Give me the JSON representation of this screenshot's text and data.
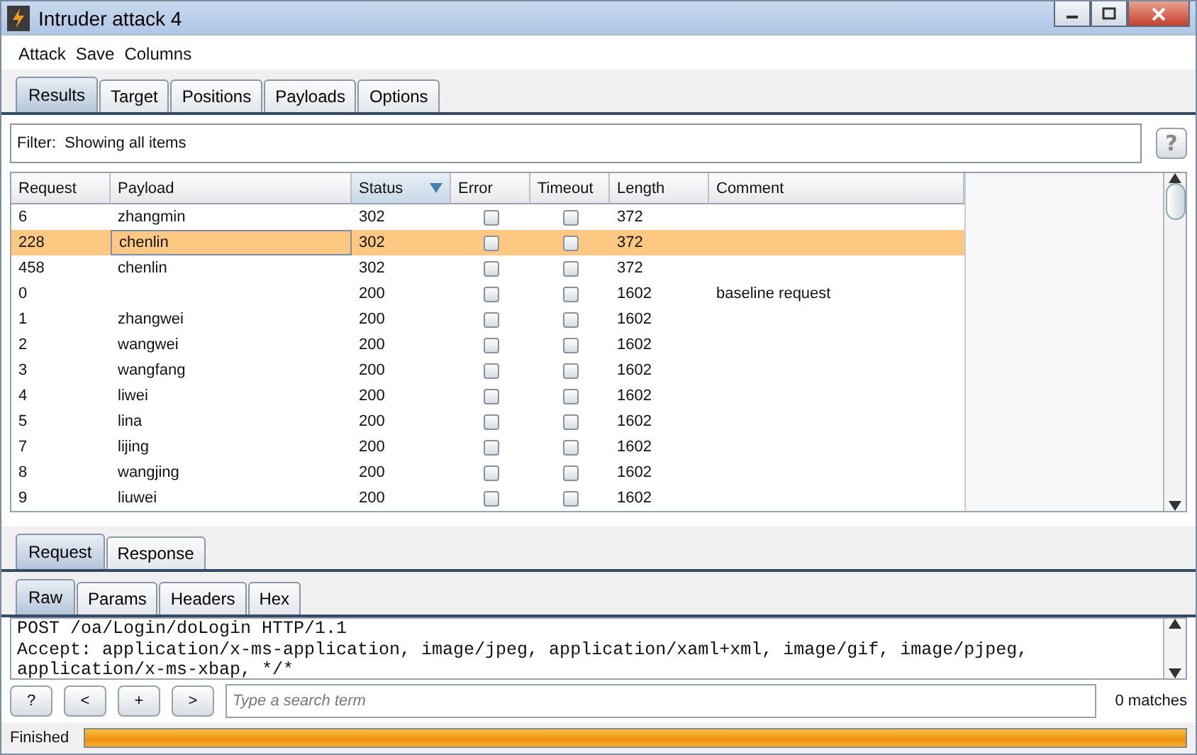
{
  "window": {
    "title": "Intruder attack 4"
  },
  "menu": [
    "Attack",
    "Save",
    "Columns"
  ],
  "tabs": [
    {
      "label": "Results",
      "selected": true
    },
    {
      "label": "Target",
      "selected": false
    },
    {
      "label": "Positions",
      "selected": false
    },
    {
      "label": "Payloads",
      "selected": false
    },
    {
      "label": "Options",
      "selected": false
    }
  ],
  "filter": {
    "label": "Filter:",
    "text": "Showing all items",
    "help": "?"
  },
  "table": {
    "columns": [
      {
        "label": "Request",
        "sorted": false
      },
      {
        "label": "Payload",
        "sorted": false
      },
      {
        "label": "Status",
        "sorted": true
      },
      {
        "label": "Error",
        "sorted": false
      },
      {
        "label": "Timeout",
        "sorted": false
      },
      {
        "label": "Length",
        "sorted": false
      },
      {
        "label": "Comment",
        "sorted": false
      }
    ],
    "rows": [
      {
        "request": "6",
        "payload": "zhangmin",
        "status": "302",
        "error": false,
        "timeout": false,
        "length": "372",
        "comment": "",
        "selected": false
      },
      {
        "request": "228",
        "payload": "chenlin",
        "status": "302",
        "error": false,
        "timeout": false,
        "length": "372",
        "comment": "",
        "selected": true
      },
      {
        "request": "458",
        "payload": "chenlin",
        "status": "302",
        "error": false,
        "timeout": false,
        "length": "372",
        "comment": "",
        "selected": false
      },
      {
        "request": "0",
        "payload": "",
        "status": "200",
        "error": false,
        "timeout": false,
        "length": "1602",
        "comment": "baseline request",
        "selected": false
      },
      {
        "request": "1",
        "payload": "zhangwei",
        "status": "200",
        "error": false,
        "timeout": false,
        "length": "1602",
        "comment": "",
        "selected": false
      },
      {
        "request": "2",
        "payload": "wangwei",
        "status": "200",
        "error": false,
        "timeout": false,
        "length": "1602",
        "comment": "",
        "selected": false
      },
      {
        "request": "3",
        "payload": "wangfang",
        "status": "200",
        "error": false,
        "timeout": false,
        "length": "1602",
        "comment": "",
        "selected": false
      },
      {
        "request": "4",
        "payload": "liwei",
        "status": "200",
        "error": false,
        "timeout": false,
        "length": "1602",
        "comment": "",
        "selected": false
      },
      {
        "request": "5",
        "payload": "lina",
        "status": "200",
        "error": false,
        "timeout": false,
        "length": "1602",
        "comment": "",
        "selected": false
      },
      {
        "request": "7",
        "payload": "lijing",
        "status": "200",
        "error": false,
        "timeout": false,
        "length": "1602",
        "comment": "",
        "selected": false
      },
      {
        "request": "8",
        "payload": "wangjing",
        "status": "200",
        "error": false,
        "timeout": false,
        "length": "1602",
        "comment": "",
        "selected": false
      },
      {
        "request": "9",
        "payload": "liuwei",
        "status": "200",
        "error": false,
        "timeout": false,
        "length": "1602",
        "comment": "",
        "selected": false
      }
    ]
  },
  "message_tabs": [
    {
      "label": "Request",
      "selected": true
    },
    {
      "label": "Response",
      "selected": false
    }
  ],
  "view_tabs": [
    {
      "label": "Raw",
      "selected": true
    },
    {
      "label": "Params",
      "selected": false
    },
    {
      "label": "Headers",
      "selected": false
    },
    {
      "label": "Hex",
      "selected": false
    }
  ],
  "raw_lines": [
    "POST /oa/Login/doLogin HTTP/1.1",
    "Accept: application/x-ms-application, image/jpeg, application/xaml+xml, image/gif, image/pjpeg,",
    "application/x-ms-xbap, */*"
  ],
  "search": {
    "buttons": [
      "?",
      "<",
      "+",
      ">"
    ],
    "placeholder": "Type a search term",
    "matches": "0 matches"
  },
  "status": {
    "text": "Finished",
    "level": 1
  }
}
